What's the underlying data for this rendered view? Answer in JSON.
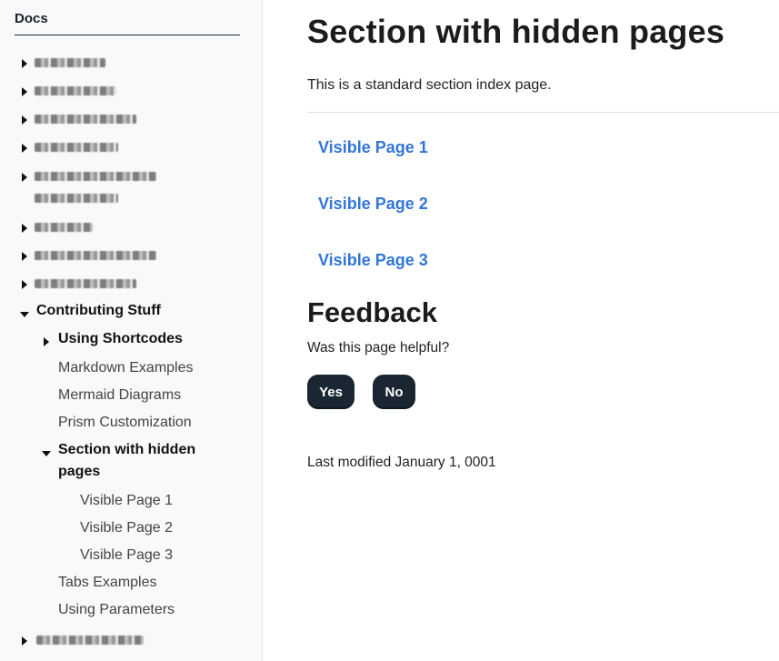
{
  "sidebar": {
    "title": "Docs",
    "contributing": "Contributing Stuff",
    "using_shortcodes": "Using Shortcodes",
    "markdown_examples": "Markdown Examples",
    "mermaid_diagrams": "Mermaid Diagrams",
    "prism_customization": "Prism Customization",
    "section_hidden_line1": "Section with hidden",
    "section_hidden_line2": "pages",
    "visible_page_1": "Visible Page 1",
    "visible_page_2": "Visible Page 2",
    "visible_page_3": "Visible Page 3",
    "tabs_examples": "Tabs Examples",
    "using_parameters": "Using Parameters"
  },
  "main": {
    "title": "Section with hidden pages",
    "lead": "This is a standard section index page.",
    "links": [
      "Visible Page 1",
      "Visible Page 2",
      "Visible Page 3"
    ],
    "feedback_title": "Feedback",
    "feedback_question": "Was this page helpful?",
    "yes_label": "Yes",
    "no_label": "No",
    "last_modified": "Last modified January 1, 0001"
  }
}
